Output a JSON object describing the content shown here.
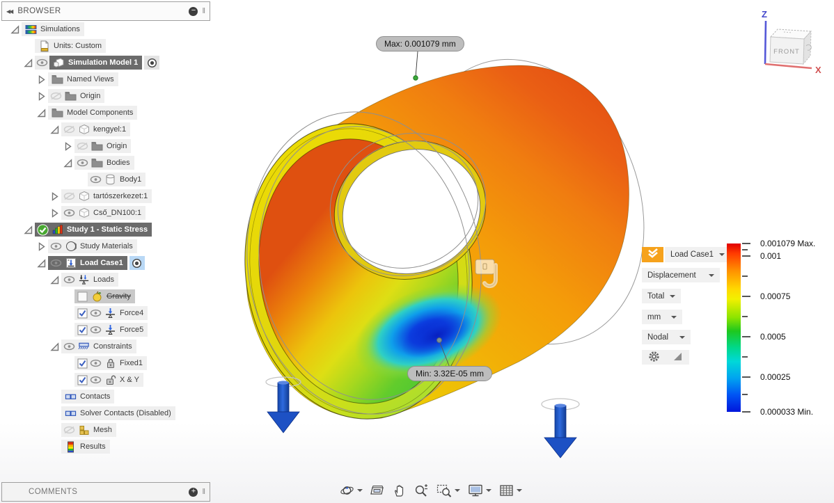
{
  "browser_panel": {
    "title": "BROWSER",
    "collapse_icon": "chevrons-left-icon",
    "minimize_icon": "minus-circle-icon",
    "grip": "‖"
  },
  "comments_panel": {
    "title": "COMMENTS",
    "add_icon": "plus-circle-icon",
    "grip": "‖"
  },
  "tree": {
    "rows": [
      {
        "name": "simulations",
        "label": "Simulations",
        "level": 0,
        "expander": "open",
        "icon": "simulations",
        "band": "light"
      },
      {
        "name": "units-custom",
        "label": "Units: Custom",
        "level": 1,
        "icon": "units",
        "band": "light"
      },
      {
        "name": "simulation-model-1",
        "label": "Simulation Model 1",
        "level": 1,
        "expander": "open",
        "eye": "on",
        "icon": "model",
        "band": "dark",
        "band_start": "icon",
        "radio": "plain"
      },
      {
        "name": "named-views",
        "label": "Named Views",
        "level": 2,
        "expander": "closed",
        "icon": "folder",
        "band": "light"
      },
      {
        "name": "origin",
        "label": "Origin",
        "level": 2,
        "expander": "closed",
        "eye": "off",
        "icon": "folder",
        "band": "light"
      },
      {
        "name": "model-components",
        "label": "Model Components",
        "level": 2,
        "expander": "open",
        "icon": "folder",
        "band": "light"
      },
      {
        "name": "kengyel-1",
        "label": "kengyel:1",
        "level": 3,
        "expander": "open",
        "eye": "off",
        "icon": "cube",
        "band": "light"
      },
      {
        "name": "origin-kengyel",
        "label": "Origin",
        "level": 4,
        "expander": "closed",
        "eye": "off",
        "icon": "folder",
        "band": "light"
      },
      {
        "name": "bodies",
        "label": "Bodies",
        "level": 4,
        "expander": "open",
        "eye": "on",
        "icon": "folder",
        "band": "light"
      },
      {
        "name": "body1",
        "label": "Body1",
        "level": 5,
        "eye": "on",
        "icon": "cylinder",
        "band": "light"
      },
      {
        "name": "tartoszerkezet-1",
        "label": "tartószerkezet:1",
        "level": 3,
        "expander": "closed",
        "eye": "off",
        "icon": "cube",
        "band": "light"
      },
      {
        "name": "cso-dn100-1",
        "label": "Cső_DN100:1",
        "level": 3,
        "expander": "closed",
        "eye": "on",
        "icon": "cube",
        "band": "light"
      },
      {
        "name": "study-1-static-stress",
        "label": "Study 1 - Static Stress",
        "level": 1,
        "expander": "open",
        "badge": "check",
        "icon": "study",
        "band": "dark"
      },
      {
        "name": "study-materials",
        "label": "Study Materials",
        "level": 2,
        "expander": "closed",
        "eye": "on",
        "icon": "materials",
        "band": "light"
      },
      {
        "name": "load-case1",
        "label": "Load Case1",
        "level": 2,
        "expander": "open",
        "eye": "on",
        "icon": "loadcase",
        "band": "dark",
        "radio": "blue"
      },
      {
        "name": "loads",
        "label": "Loads",
        "level": 3,
        "expander": "open",
        "eye": "on",
        "icon": "loads",
        "band": "light"
      },
      {
        "name": "gravity",
        "label": "Gravity",
        "level": 4,
        "checkbox": "off",
        "icon": "apple",
        "band": "gray",
        "strike": true
      },
      {
        "name": "force4",
        "label": "Force4",
        "level": 4,
        "checkbox": "on",
        "eye": "on",
        "icon": "force",
        "band": "light"
      },
      {
        "name": "force5",
        "label": "Force5",
        "level": 4,
        "checkbox": "on",
        "eye": "on",
        "icon": "force",
        "band": "light"
      },
      {
        "name": "constraints",
        "label": "Constraints",
        "level": 3,
        "expander": "open",
        "eye": "on",
        "icon": "constraints",
        "band": "light"
      },
      {
        "name": "fixed1",
        "label": "Fixed1",
        "level": 4,
        "checkbox": "on",
        "eye": "on",
        "icon": "lock",
        "band": "light"
      },
      {
        "name": "x-y",
        "label": "X & Y",
        "level": 4,
        "checkbox": "on",
        "eye": "on",
        "icon": "unlock",
        "band": "light"
      },
      {
        "name": "contacts",
        "label": "Contacts",
        "level": 3,
        "icon": "contacts",
        "band": "light"
      },
      {
        "name": "solver-contacts",
        "label": "Solver Contacts (Disabled)",
        "level": 3,
        "icon": "contacts",
        "band": "light"
      },
      {
        "name": "mesh",
        "label": "Mesh",
        "level": 3,
        "eye": "off",
        "icon": "mesh",
        "band": "light"
      },
      {
        "name": "results",
        "label": "Results",
        "level": 3,
        "icon": "results",
        "band": "light"
      }
    ]
  },
  "viewport": {
    "annotations": {
      "max": "Max: 0.001079 mm",
      "min": "Min: 3.32E-05 mm"
    },
    "viewcube": {
      "front": "FRONT",
      "axis_z": "Z",
      "axis_x": "X"
    }
  },
  "legend": {
    "load_case_button_icon": "double-check-icon",
    "load_case": "Load Case1",
    "result_type": "Displacement",
    "component": "Total",
    "unit": "mm",
    "averaging": "Nodal",
    "settings_icon": "gear-icon",
    "resize_icon": "corner-triangle-icon",
    "scale": {
      "max_value": 0.001079,
      "min_value": 3.3e-05,
      "unit": "mm",
      "ticks": [
        {
          "label": "0.001079 Max.",
          "pos": 0
        },
        {
          "label": "0.001",
          "pos": 7.6
        },
        {
          "label": "0.00075",
          "pos": 31.5
        },
        {
          "label": "0.0005",
          "pos": 55.4
        },
        {
          "label": "0.00025",
          "pos": 79.3
        },
        {
          "label": "0.000033 Min.",
          "pos": 100
        }
      ],
      "colors_top_to_bottom": [
        "#e10000",
        "#ff9000",
        "#ffd800",
        "#1ec81e",
        "#00d8d8",
        "#0016dc"
      ]
    }
  },
  "toolbar": {
    "items": [
      {
        "name": "orbit",
        "dropdown": true
      },
      {
        "name": "look-at",
        "dropdown": false
      },
      {
        "name": "pan",
        "dropdown": false
      },
      {
        "name": "zoom",
        "dropdown": false
      },
      {
        "name": "zoom-window",
        "dropdown": true
      },
      {
        "name": "display-settings",
        "dropdown": true
      },
      {
        "name": "grid-display",
        "dropdown": true
      }
    ]
  }
}
